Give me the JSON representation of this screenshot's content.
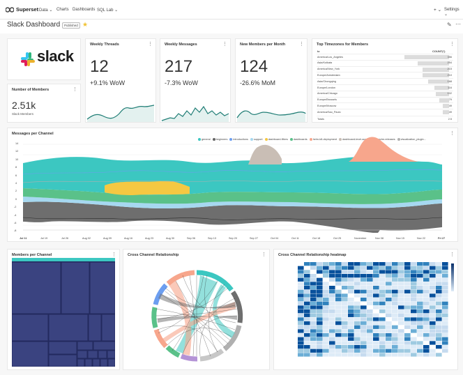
{
  "nav": {
    "brand": "Superset",
    "menu": [
      "Data ⌄",
      "Charts",
      "Dashboards",
      "SQL Lab ⌄"
    ],
    "plus": "+ ⌄",
    "settings": "Settings ⌄"
  },
  "header": {
    "title": "Slack Dashboard",
    "badge": "Published",
    "star": "★",
    "edit": "✎",
    "more": "⋯"
  },
  "slack_logo_text": "slack",
  "cards": {
    "members": {
      "title": "Number of Members",
      "value": "2.51k",
      "sub": "Slack Members"
    },
    "threads": {
      "title": "Weekly Threads",
      "value": "12",
      "delta": "+9.1% WoW"
    },
    "messages": {
      "title": "Weekly Messages",
      "value": "217",
      "delta": "-7.3% WoW"
    },
    "new_members": {
      "title": "New Members per Month",
      "value": "124",
      "delta": "-26.6% MoM"
    },
    "timezones": {
      "title": "Top Timezones for Members",
      "col_tz": "tz",
      "col_count": "COUNT(*)",
      "rows": [
        {
          "tz": "America/Los_Angeles",
          "count": "356",
          "frac": 1.0
        },
        {
          "tz": "Asia/Kolkata",
          "count": "254",
          "frac": 0.71
        },
        {
          "tz": "America/New_York",
          "count": "215",
          "frac": 0.6
        },
        {
          "tz": "Europe/Amsterdam",
          "count": "210",
          "frac": 0.59
        },
        {
          "tz": "Asia/Chongqing",
          "count": "168",
          "frac": 0.47
        },
        {
          "tz": "Europe/London",
          "count": "116",
          "frac": 0.33
        },
        {
          "tz": "America/Chicago",
          "count": "102",
          "frac": 0.29
        },
        {
          "tz": "Europe/Brussels",
          "count": "79",
          "frac": 0.22
        },
        {
          "tz": "Europe/Moscow",
          "count": "49",
          "frac": 0.14
        },
        {
          "tz": "America/Sao_Paulo",
          "count": "49",
          "frac": 0.14
        }
      ],
      "total_label": "Totals",
      "total_value": "2.5"
    },
    "mpc": {
      "title": "Messages per Channel"
    },
    "members_per_channel": {
      "title": "Members per Channel"
    },
    "cross": {
      "title": "Cross Channel Relationship"
    },
    "heatmap": {
      "title": "Cross Channel Relationship heatmap"
    }
  },
  "menu_icon": "⋮",
  "colors": {
    "general": "#3cc7c1",
    "beginners": "#666666",
    "introductions": "#6c9ef0",
    "support": "#a6d8f0",
    "dashboard-filters": "#f5c842",
    "dashboards": "#5ac189",
    "helm-k8-deployment": "#f7a68c",
    "dashboard-level-access": "#c9beb5",
    "apache-releases": "#2b2b2b",
    "visualization_plugins": "#b0b0b0"
  },
  "chart_data": {
    "type": "area",
    "title": "Messages per Channel",
    "ylim": [
      0,
      14
    ],
    "yticks": [
      "14",
      "12",
      "10",
      "8",
      "6",
      "4",
      "2",
      "0",
      "-2",
      "-4",
      "-6",
      "-8"
    ],
    "xticks": [
      "Jul 11",
      "Jul 19",
      "Jul 26",
      "Aug 02",
      "Aug 09",
      "Aug 16",
      "Aug 23",
      "Aug 30",
      "Sep 06",
      "Sep 13",
      "Sep 20",
      "Sep 27",
      "Oct 04",
      "Oct 11",
      "Oct 18",
      "Oct 25",
      "November",
      "Nov 08",
      "Nov 15",
      "Nov 22",
      "Fri 27"
    ],
    "legend": [
      "general",
      "beginners",
      "introductions",
      "support",
      "dashboard-filters",
      "dashboards",
      "helm-k8-deployment",
      "dashboard-level-acce...",
      "apache-releases",
      "visualization_plugin..."
    ]
  }
}
